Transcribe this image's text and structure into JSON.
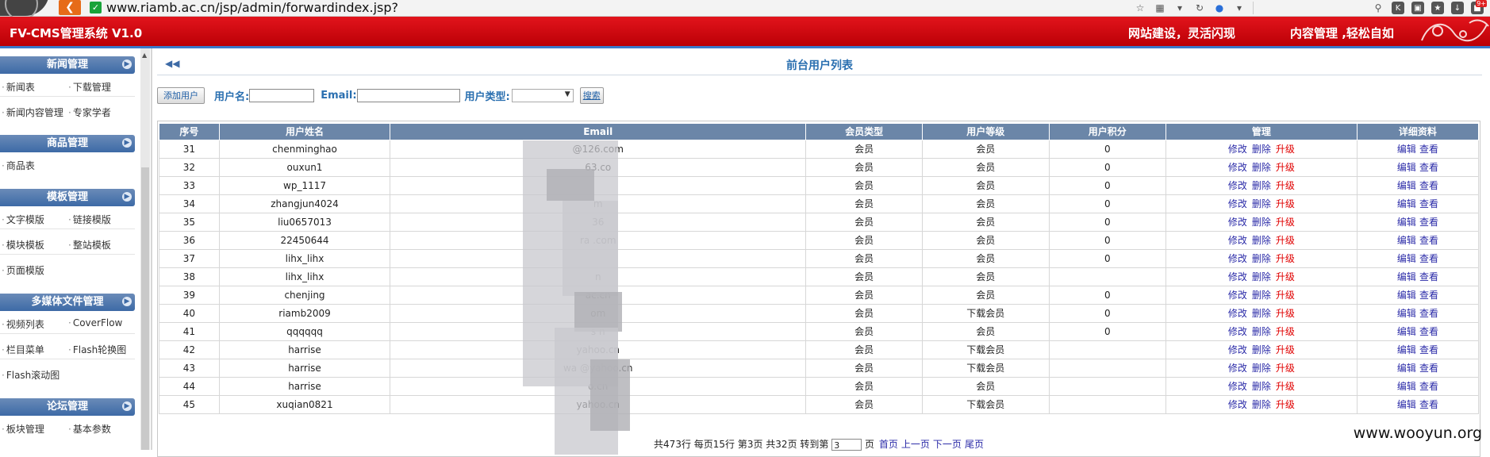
{
  "browser": {
    "back_icon": "back-arrow-icon",
    "url": "www.riamb.ac.cn/jsp/admin/forwardindex.jsp?",
    "icons": [
      "star-icon",
      "dropdown-icon",
      "refresh-icon",
      "paw-icon",
      "search-icon",
      "k-icon",
      "lock-icon",
      "bookmark-icon",
      "download-icon",
      "extension-icon"
    ],
    "badge": "9+"
  },
  "header": {
    "title": "FV-CMS管理系统 V1.0",
    "slogan1": "网站建设，灵活闪现",
    "slogan2": "内容管理 ,轻松自如"
  },
  "sidebar": {
    "sections": [
      {
        "title": "新闻管理",
        "items": [
          "新闻表",
          "下载管理",
          "新闻内容管理",
          "专家学者"
        ]
      },
      {
        "title": "商品管理",
        "items": [
          "商品表"
        ]
      },
      {
        "title": "模板管理",
        "items": [
          "文字模版",
          "链接模版",
          "模块模板",
          "整站模板",
          "页面模版"
        ]
      },
      {
        "title": "多媒体文件管理",
        "items": [
          "视频列表",
          "CoverFlow",
          "栏目菜单",
          "Flash轮换图",
          "Flash滚动图"
        ]
      },
      {
        "title": "论坛管理",
        "items": [
          "板块管理",
          "基本参数"
        ]
      }
    ]
  },
  "main": {
    "page_title": "前台用户列表",
    "add_button": "添加用户",
    "username_label": "用户名:",
    "username_value": "",
    "email_label": "Email:",
    "email_value": "",
    "usertype_label": "用户类型:",
    "usertype_value": "",
    "search_button": "搜索"
  },
  "table": {
    "columns": [
      "序号",
      "用户姓名",
      "Email",
      "会员类型",
      "用户等级",
      "用户积分",
      "管理",
      "详细资料"
    ],
    "ops": {
      "modify": "修改",
      "delete": "删除",
      "upgrade": "升级",
      "edit": "编辑",
      "view": "查看"
    },
    "rows": [
      {
        "no": "31",
        "name": "chenminghao",
        "email": "@126.com",
        "type": "会员",
        "level": "会员",
        "points": "0"
      },
      {
        "no": "32",
        "name": "ouxun1",
        "email": "63.co",
        "type": "会员",
        "level": "会员",
        "points": "0"
      },
      {
        "no": "33",
        "name": "wp_1117",
        "email": "",
        "type": "会员",
        "level": "会员",
        "points": "0"
      },
      {
        "no": "34",
        "name": "zhangjun4024",
        "email": "m",
        "type": "会员",
        "level": "会员",
        "points": "0"
      },
      {
        "no": "35",
        "name": "liu0657013",
        "email": "36",
        "type": "会员",
        "level": "会员",
        "points": "0"
      },
      {
        "no": "36",
        "name": "22450644",
        "email": "ra .com",
        "type": "会员",
        "level": "会员",
        "points": "0"
      },
      {
        "no": "37",
        "name": "lihx_lihx",
        "email": "",
        "type": "会员",
        "level": "会员",
        "points": "0"
      },
      {
        "no": "38",
        "name": "lihx_lihx",
        "email": "n",
        "type": "会员",
        "level": "会员",
        "points": ""
      },
      {
        "no": "39",
        "name": "chenjing",
        "email": "ac.cn",
        "type": "会员",
        "level": "会员",
        "points": "0"
      },
      {
        "no": "40",
        "name": "riamb2009",
        "email": "om",
        "type": "会员",
        "level": "下载会员",
        "points": "0"
      },
      {
        "no": "41",
        "name": "qqqqqq",
        "email": "s n",
        "type": "会员",
        "level": "会员",
        "points": "0"
      },
      {
        "no": "42",
        "name": "harrise",
        "email": "yahoo.cn",
        "type": "会员",
        "level": "下载会员",
        "points": ""
      },
      {
        "no": "43",
        "name": "harrise",
        "email": "wa @yahoo.cn",
        "type": "会员",
        "level": "下载会员",
        "points": ""
      },
      {
        "no": "44",
        "name": "harrise",
        "email": "o.cn",
        "type": "会员",
        "level": "会员",
        "points": ""
      },
      {
        "no": "45",
        "name": "xuqian0821",
        "email": "yahoo.cn",
        "type": "会员",
        "level": "下载会员",
        "points": ""
      }
    ]
  },
  "pager": {
    "summary": "共473行 每页15行  第3页 共32页  转到第",
    "page_input": "3",
    "page_unit": "页",
    "first": "首页",
    "prev": "上一页",
    "next": "下一页",
    "last": "尾页"
  },
  "watermark": "www.wooyun.org"
}
